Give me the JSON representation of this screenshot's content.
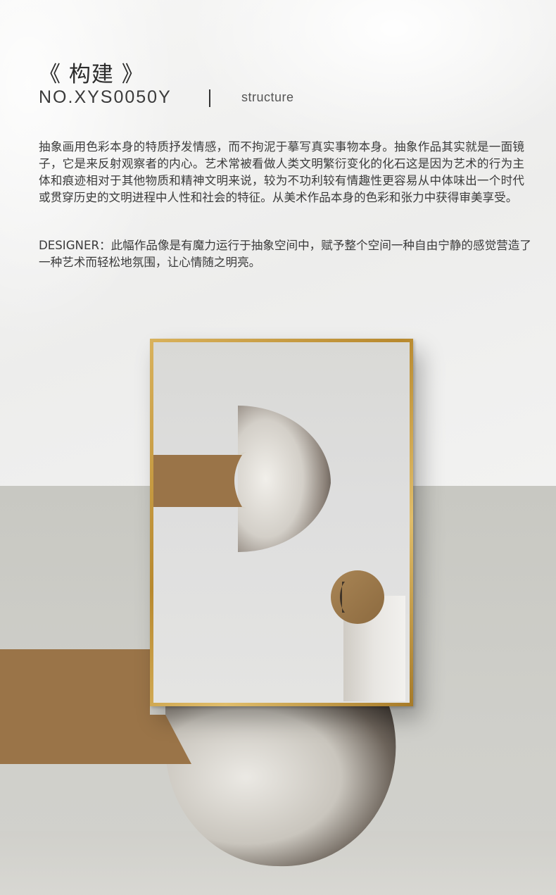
{
  "header": {
    "title": "《 构建 》",
    "code": "NO.XYS0050Y",
    "subtitle": "structure"
  },
  "description": "抽象画用色彩本身的特质抒发情感，而不拘泥于摹写真实事物本身。抽象作品其实就是一面镜子，它是来反射观察者的内心。艺术常被看做人类文明繁衍变化的化石这是因为艺术的行为主体和痕迹相对于其他物质和精神文明来说，较为不功利较有情趣性更容易从中体味出一个时代或贯穿历史的文明进程中人性和社会的特征。从美术作品本身的色彩和张力中获得审美享受。",
  "designer_note": "DESIGNER：此幅作品像是有魔力运行于抽象空间中，赋予整个空间一种自由宁静的感觉营造了一种艺术而轻松地氛围，让心情随之明亮。",
  "colors": {
    "bronze": "#9a7448",
    "gold_frame": "#c9a04a",
    "wall_top": "#f3f3f2",
    "wall_bottom": "#cbcbc6"
  }
}
